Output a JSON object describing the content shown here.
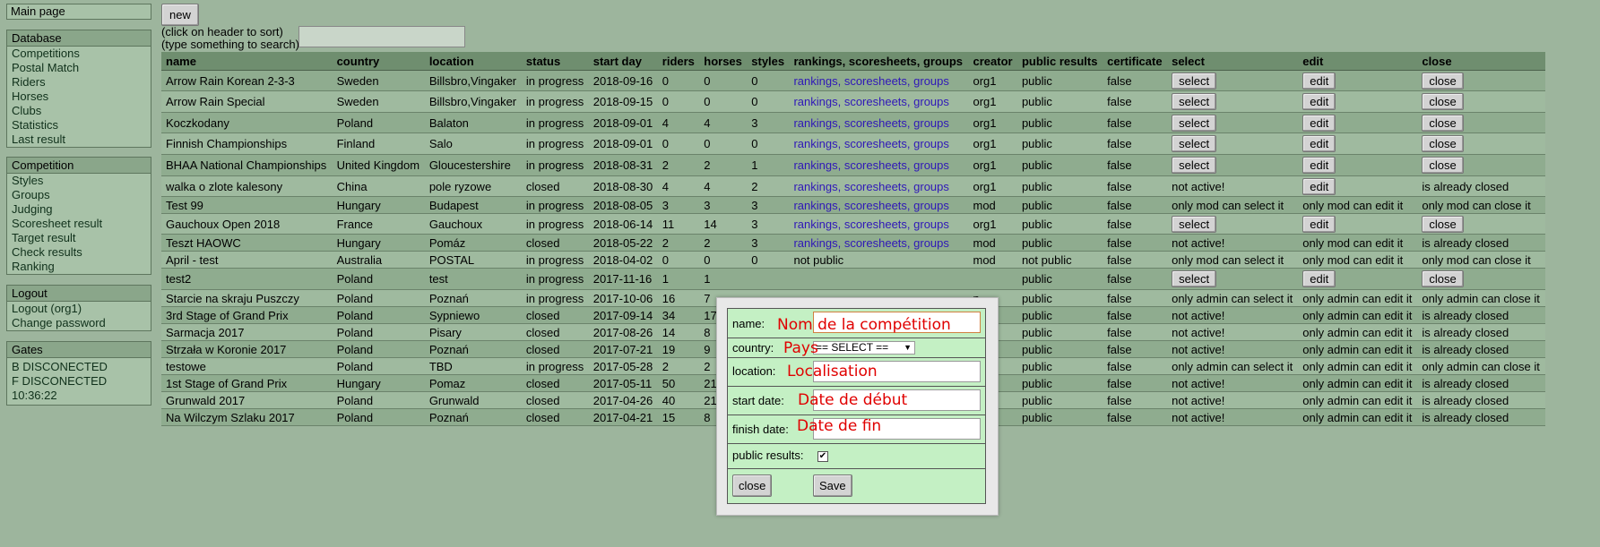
{
  "sidebar": {
    "main_page": "Main page",
    "database": {
      "title": "Database",
      "items": [
        "Competitions",
        "Postal Match",
        "Riders",
        "Horses",
        "Clubs",
        "Statistics",
        "Last result"
      ]
    },
    "competition": {
      "title": "Competition",
      "items": [
        "Styles",
        "Groups",
        "Judging",
        "Scoresheet result",
        "Target result",
        "Check results",
        "Ranking"
      ]
    },
    "logout": {
      "title": "Logout",
      "items": [
        "Logout (org1)",
        "Change password"
      ]
    },
    "gates": {
      "title": "Gates",
      "items": [
        "B DISCONECTED",
        "F DISCONECTED",
        "10:36:22"
      ]
    }
  },
  "toolbar": {
    "new_label": "new",
    "hint1": "(click on header to sort)",
    "hint2": "(type something to search)",
    "search_value": ""
  },
  "table": {
    "headers": [
      "name",
      "country",
      "location",
      "status",
      "start day",
      "riders",
      "horses",
      "styles",
      "rankings, scoresheets, groups",
      "creator",
      "public results",
      "certificate",
      "select",
      "edit",
      "close"
    ],
    "rows": [
      [
        "Arrow Rain Korean 2-3-3",
        "Sweden",
        "Billsbro,Vingaker",
        "in progress",
        "2018-09-16",
        "0",
        "0",
        "0",
        "rankings, scoresheets, groups",
        "org1",
        "public",
        "false",
        "select",
        "edit",
        "close"
      ],
      [
        "Arrow Rain Special",
        "Sweden",
        "Billsbro,Vingaker",
        "in progress",
        "2018-09-15",
        "0",
        "0",
        "0",
        "rankings, scoresheets, groups",
        "org1",
        "public",
        "false",
        "select",
        "edit",
        "close"
      ],
      [
        "Koczkodany",
        "Poland",
        "Balaton",
        "in progress",
        "2018-09-01",
        "4",
        "4",
        "3",
        "rankings, scoresheets, groups",
        "org1",
        "public",
        "false",
        "select",
        "edit",
        "close"
      ],
      [
        "Finnish Championships",
        "Finland",
        "Salo",
        "in progress",
        "2018-09-01",
        "0",
        "0",
        "0",
        "rankings, scoresheets, groups",
        "org1",
        "public",
        "false",
        "select",
        "edit",
        "close"
      ],
      [
        "BHAA National Championships",
        "United Kingdom",
        "Gloucestershire",
        "in progress",
        "2018-08-31",
        "2",
        "2",
        "1",
        "rankings, scoresheets, groups",
        "org1",
        "public",
        "false",
        "select",
        "edit",
        "close"
      ],
      [
        "walka o zlote kalesony",
        "China",
        "pole ryzowe",
        "closed",
        "2018-08-30",
        "4",
        "4",
        "2",
        "rankings, scoresheets, groups",
        "org1",
        "public",
        "false",
        "not active!",
        "edit",
        "is already closed"
      ],
      [
        "Test 99",
        "Hungary",
        "Budapest",
        "in progress",
        "2018-08-05",
        "3",
        "3",
        "3",
        "rankings, scoresheets, groups",
        "mod",
        "public",
        "false",
        "only mod can select it",
        "only mod can edit it",
        "only mod can close it"
      ],
      [
        "Gauchoux Open 2018",
        "France",
        "Gauchoux",
        "in progress",
        "2018-06-14",
        "11",
        "14",
        "3",
        "rankings, scoresheets, groups",
        "org1",
        "public",
        "false",
        "select",
        "edit",
        "close"
      ],
      [
        "Teszt HAOWC",
        "Hungary",
        "Pomáz",
        "closed",
        "2018-05-22",
        "2",
        "2",
        "3",
        "rankings, scoresheets, groups",
        "mod",
        "public",
        "false",
        "not active!",
        "only mod can edit it",
        "is already closed"
      ],
      [
        "April - test",
        "Australia",
        "POSTAL",
        "in progress",
        "2018-04-02",
        "0",
        "0",
        "0",
        "not public",
        "mod",
        "not public",
        "false",
        "only mod can select it",
        "only mod can edit it",
        "only mod can close it"
      ],
      [
        "test2",
        "Poland",
        "test",
        "in progress",
        "2017-11-16",
        "1",
        "1",
        "",
        "",
        "",
        "public",
        "false",
        "select",
        "edit",
        "close"
      ],
      [
        "Starcie na skraju Puszczy",
        "Poland",
        "Poznań",
        "in progress",
        "2017-10-06",
        "16",
        "7",
        "",
        "",
        "n",
        "public",
        "false",
        "only admin can select it",
        "only admin can edit it",
        "only admin can close it"
      ],
      [
        "3rd Stage of Grand Prix",
        "Poland",
        "Sypniewo",
        "closed",
        "2017-09-14",
        "34",
        "17",
        "",
        "",
        "n",
        "public",
        "false",
        "not active!",
        "only admin can edit it",
        "is already closed"
      ],
      [
        "Sarmacja 2017",
        "Poland",
        "Pisary",
        "closed",
        "2017-08-26",
        "14",
        "8",
        "",
        "",
        "n",
        "public",
        "false",
        "not active!",
        "only admin can edit it",
        "is already closed"
      ],
      [
        "Strzała w Koronie 2017",
        "Poland",
        "Poznań",
        "closed",
        "2017-07-21",
        "19",
        "9",
        "",
        "",
        "n",
        "public",
        "false",
        "not active!",
        "only admin can edit it",
        "is already closed"
      ],
      [
        "testowe",
        "Poland",
        "TBD",
        "in progress",
        "2017-05-28",
        "2",
        "2",
        "",
        "",
        "n",
        "public",
        "false",
        "only admin can select it",
        "only admin can edit it",
        "only admin can close it"
      ],
      [
        "1st Stage of Grand Prix",
        "Hungary",
        "Pomaz",
        "closed",
        "2017-05-11",
        "50",
        "21",
        "",
        "",
        "n",
        "public",
        "false",
        "not active!",
        "only admin can edit it",
        "is already closed"
      ],
      [
        "Grunwald 2017",
        "Poland",
        "Grunwald",
        "closed",
        "2017-04-26",
        "40",
        "21",
        "",
        "",
        "n",
        "public",
        "false",
        "not active!",
        "only admin can edit it",
        "is already closed"
      ],
      [
        "Na Wilczym Szlaku 2017",
        "Poland",
        "Poznań",
        "closed",
        "2017-04-21",
        "15",
        "8",
        "",
        "",
        "n",
        "public",
        "false",
        "not active!",
        "only admin can edit it",
        "is already closed"
      ]
    ]
  },
  "dialog": {
    "name_label": "name:",
    "name_hint": "Nom de la compétition",
    "country_label": "country:",
    "country_hint": "Pays",
    "country_select": "== SELECT ==",
    "location_label": "location:",
    "location_hint": "Localisation",
    "start_label": "start date:",
    "start_hint": "Date de début",
    "finish_label": "finish date:",
    "finish_hint": "Date de fin",
    "public_label": "public results:",
    "public_checked": true,
    "close_label": "close",
    "save_label": "Save"
  },
  "colors": {
    "background": "#9db59d",
    "dialog_bg": "#c4f0c4",
    "annotation": "#e00000",
    "link": "#2f17b8"
  }
}
